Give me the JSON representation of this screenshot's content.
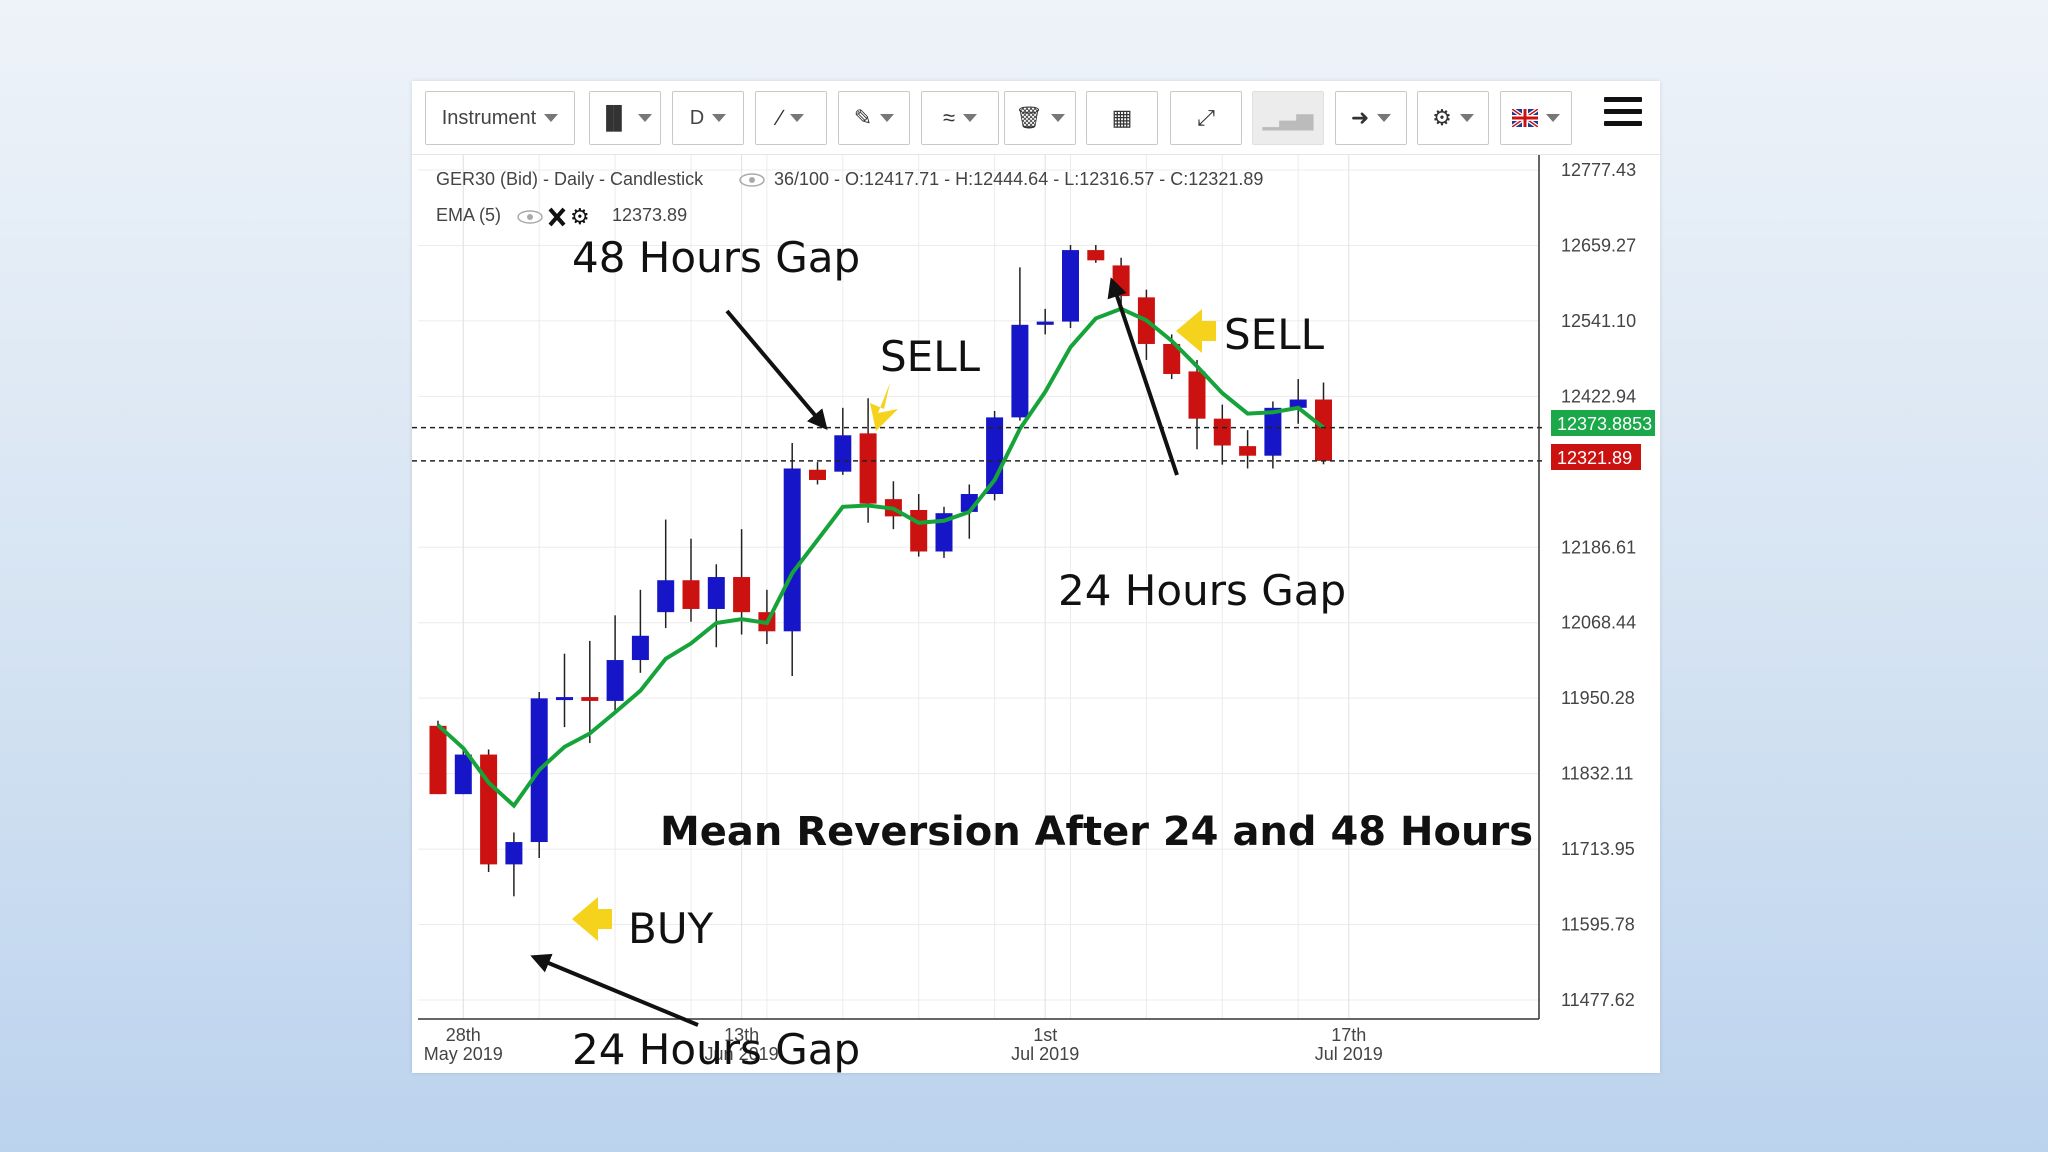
{
  "toolbar": {
    "instrument_label": "Instrument",
    "timeframe_label": "D",
    "icons": [
      "bar-chart-type-icon",
      "line-draw-icon",
      "pencil-icon",
      "indicator-icon",
      "trash-icon",
      "layout-icon",
      "fullscreen-icon",
      "volume-icon",
      "share-arrow-icon",
      "settings-cog-icon",
      "uk-flag-icon",
      "menu-icon"
    ]
  },
  "colors": {
    "bull": "#1616c8",
    "bear": "#cc1111",
    "ema": "#16a33a",
    "ema_price_bg": "#1aa84a",
    "last_price_bg": "#cc1111",
    "arrow_yellow": "#f5d21b"
  },
  "header": {
    "instrument_line": "GER30 (Bid) - Daily - Candlestick",
    "ohlc_line": "36/100 - O:12417.71 - H:12444.64 - L:12316.57 - C:12321.89",
    "ema_label": "EMA (5)",
    "ema_value": "12373.89"
  },
  "price_tags": {
    "ema_tag": "12373.8853",
    "last_tag": "12321.89"
  },
  "annotations": {
    "title": "Mean Reversion After 24 and 48 Hours",
    "gap48": "48 Hours Gap",
    "gap24_top": "24 Hours Gap",
    "gap24_bottom": "24 Hours Gap",
    "sell1": "SELL",
    "sell2": "SELL",
    "buy": "BUY"
  },
  "chart_data": {
    "type": "candlestick",
    "title": "GER30 (Bid) - Daily - Candlestick",
    "y_ticks": [
      12777.43,
      12659.27,
      12541.1,
      12422.94,
      12186.61,
      12068.44,
      11950.28,
      11832.11,
      11713.95,
      11595.78,
      11477.62
    ],
    "ylim": [
      11477.62,
      12777.43
    ],
    "x_ticks": [
      {
        "index": 1,
        "day": "28th",
        "month": "May 2019"
      },
      {
        "index": 12,
        "day": "13th",
        "month": "Jun 2019"
      },
      {
        "index": 24,
        "day": "1st",
        "month": "Jul 2019"
      },
      {
        "index": 36,
        "day": "17th",
        "month": "Jul 2019"
      }
    ],
    "candles": [
      {
        "o": 11907,
        "h": 11915,
        "l": 11800,
        "c": 11800
      },
      {
        "o": 11800,
        "h": 11870,
        "l": 11800,
        "c": 11862
      },
      {
        "o": 11862,
        "h": 11870,
        "l": 11678,
        "c": 11690
      },
      {
        "o": 11690,
        "h": 11740,
        "l": 11640,
        "c": 11725
      },
      {
        "o": 11725,
        "h": 11960,
        "l": 11700,
        "c": 11950
      },
      {
        "o": 11948,
        "h": 12020,
        "l": 11905,
        "c": 11952
      },
      {
        "o": 11952,
        "h": 12040,
        "l": 11880,
        "c": 11946
      },
      {
        "o": 11946,
        "h": 12080,
        "l": 11930,
        "c": 12010
      },
      {
        "o": 12010,
        "h": 12120,
        "l": 11990,
        "c": 12048
      },
      {
        "o": 12085,
        "h": 12230,
        "l": 12060,
        "c": 12135
      },
      {
        "o": 12135,
        "h": 12200,
        "l": 12070,
        "c": 12090
      },
      {
        "o": 12090,
        "h": 12160,
        "l": 12030,
        "c": 12140
      },
      {
        "o": 12140,
        "h": 12215,
        "l": 12050,
        "c": 12085
      },
      {
        "o": 12085,
        "h": 12120,
        "l": 12035,
        "c": 12055
      },
      {
        "o": 12055,
        "h": 12350,
        "l": 11985,
        "c": 12310
      },
      {
        "o": 12308,
        "h": 12320,
        "l": 12285,
        "c": 12292
      },
      {
        "o": 12305,
        "h": 12405,
        "l": 12300,
        "c": 12362
      },
      {
        "o": 12365,
        "h": 12420,
        "l": 12225,
        "c": 12255
      },
      {
        "o": 12262,
        "h": 12290,
        "l": 12215,
        "c": 12235
      },
      {
        "o": 12245,
        "h": 12270,
        "l": 12172,
        "c": 12180
      },
      {
        "o": 12180,
        "h": 12250,
        "l": 12170,
        "c": 12240
      },
      {
        "o": 12242,
        "h": 12285,
        "l": 12200,
        "c": 12270
      },
      {
        "o": 12270,
        "h": 12400,
        "l": 12260,
        "c": 12390
      },
      {
        "o": 12390,
        "h": 12625,
        "l": 12385,
        "c": 12535
      },
      {
        "o": 12535,
        "h": 12560,
        "l": 12520,
        "c": 12540
      },
      {
        "o": 12540,
        "h": 12660,
        "l": 12530,
        "c": 12652
      },
      {
        "o": 12652,
        "h": 12660,
        "l": 12632,
        "c": 12636
      },
      {
        "o": 12628,
        "h": 12640,
        "l": 12560,
        "c": 12580
      },
      {
        "o": 12578,
        "h": 12590,
        "l": 12480,
        "c": 12505
      },
      {
        "o": 12505,
        "h": 12520,
        "l": 12450,
        "c": 12458
      },
      {
        "o": 12462,
        "h": 12480,
        "l": 12340,
        "c": 12388
      },
      {
        "o": 12388,
        "h": 12410,
        "l": 12316,
        "c": 12346
      },
      {
        "o": 12345,
        "h": 12370,
        "l": 12310,
        "c": 12330
      },
      {
        "o": 12330,
        "h": 12415,
        "l": 12310,
        "c": 12405
      },
      {
        "o": 12405,
        "h": 12450,
        "l": 12380,
        "c": 12418
      },
      {
        "o": 12418,
        "h": 12444.64,
        "l": 12316.57,
        "c": 12321.89
      }
    ],
    "ema": [
      11908,
      11872,
      11818,
      11782,
      11838,
      11874,
      11895,
      11928,
      11962,
      12012,
      12036,
      12068,
      12074,
      12068,
      12146,
      12198,
      12250,
      12252,
      12247,
      12225,
      12228,
      12242,
      12292,
      12372,
      12430,
      12500,
      12545,
      12560,
      12542,
      12510,
      12470,
      12428,
      12396,
      12398,
      12405,
      12373.89
    ],
    "reference_lines": [
      12373.8853,
      12321.89
    ],
    "grid": true
  }
}
